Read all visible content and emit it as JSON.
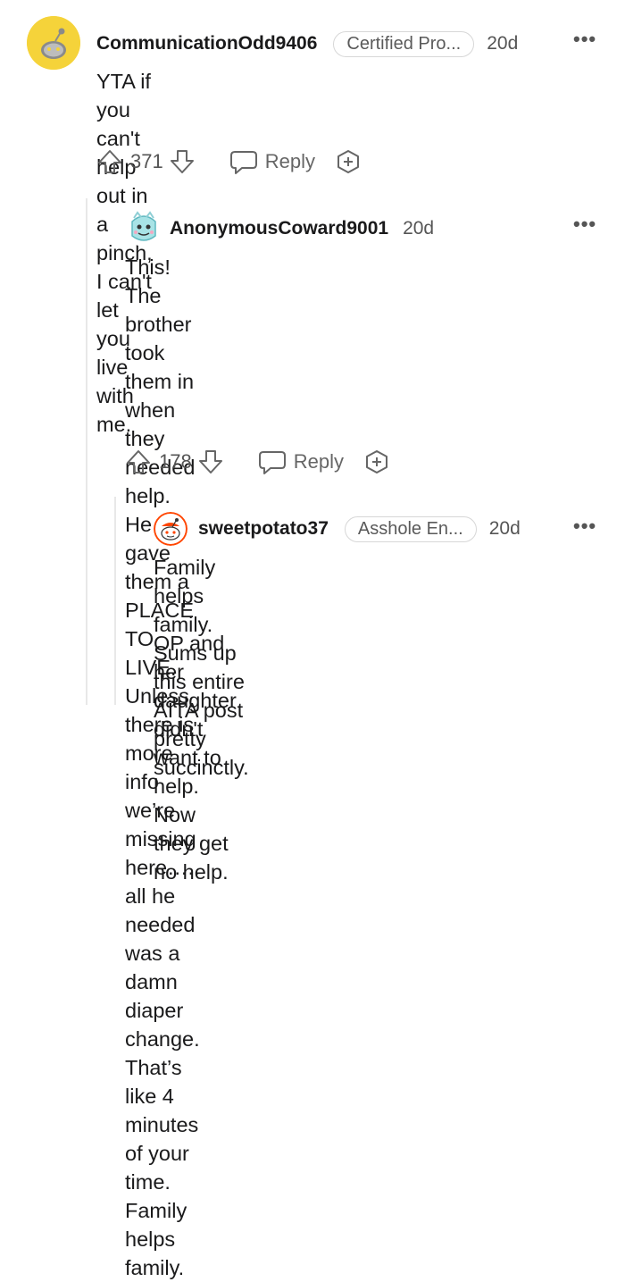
{
  "comments": [
    {
      "username": "CommunicationOdd9406",
      "flair": "Certified Pro...",
      "age": "20d",
      "body": [
        "YTA if you can't help out in a pinch, I can't let",
        "you live with me."
      ],
      "votes": "371",
      "reply_label": "Reply"
    },
    {
      "username": "AnonymousCoward9001",
      "age": "20d",
      "body": [
        "This! The brother took them in when they",
        "needed help. He gave them a PLACE TO",
        "LIVE. Unless there is more info we’re",
        "missing here….. all he needed was a damn",
        "diaper change. That’s like 4 minutes of your",
        "time. Family helps family."
      ],
      "votes": "178",
      "reply_label": "Reply"
    },
    {
      "username": "sweetpotato37",
      "flair": "Asshole En...",
      "age": "20d",
      "body": [
        "Family helps family. Sums up this entire",
        "AITA post pretty succinctly."
      ],
      "body2": [
        "OP and her daughter didn't want to help.",
        "Now they get no help."
      ]
    }
  ],
  "colors": {
    "text": "#1a1a1b",
    "muted": "#666666",
    "flair_border": "#d7d7d7",
    "thread_line": "#e8e8e8"
  },
  "icons": [
    "upvote-icon",
    "downvote-icon",
    "reply-icon",
    "award-icon",
    "more-icon"
  ]
}
